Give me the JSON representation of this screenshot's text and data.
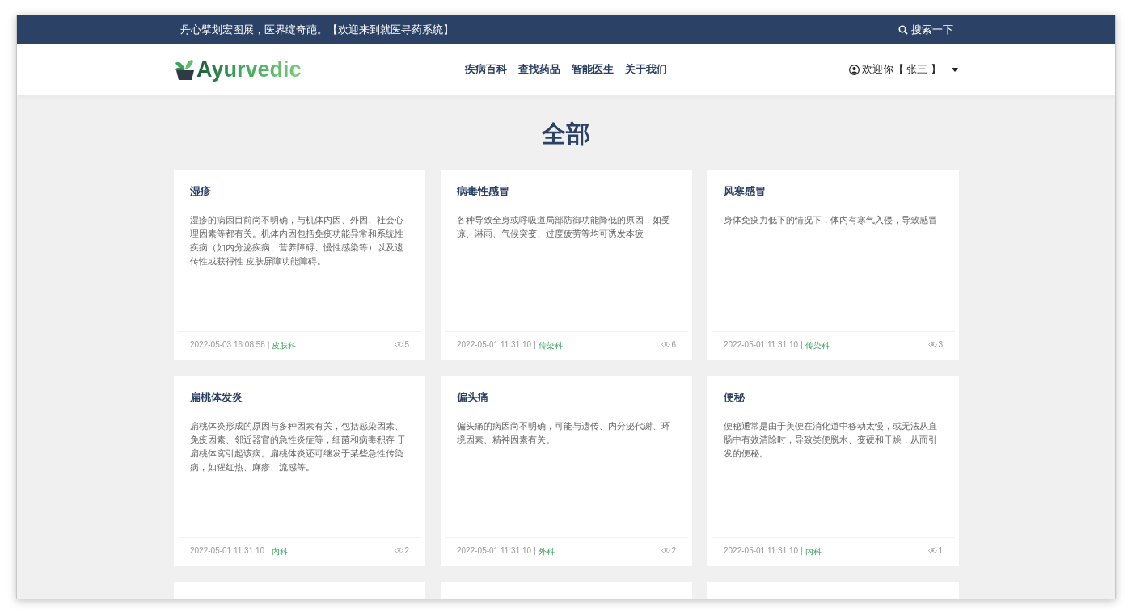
{
  "top_bar": {
    "slogan": "丹心擘划宏图展，医界绽奇葩。【欢迎来到就医寻药系统】",
    "search": "搜索一下"
  },
  "nav": {
    "logo": "Ayurvedic",
    "links": [
      {
        "label": "疾病百科"
      },
      {
        "label": "查找药品"
      },
      {
        "label": "智能医生"
      },
      {
        "label": "关于我们"
      }
    ],
    "user": "欢迎你【 张三 】"
  },
  "heading": "全部",
  "cards": [
    {
      "title": "湿疹",
      "description": "湿疹的病因目前尚不明确，与机体内因、外因、社会心理因素等都有关。机体内因包括免疫功能异常和系统性疾病（如内分泌疾病、营养障碍、慢性感染等）以及遗传性或获得性 皮肤屏障功能障碍。",
      "date": "2022-05-03 16:08:58",
      "separator": "|",
      "department": "皮肤科",
      "views": "5"
    },
    {
      "title": "病毒性感冒",
      "description": "各种导致全身或呼吸道局部防御功能降低的原因，如受凉、淋雨、气候突变、过度疲劳等均可诱发本疲",
      "date": "2022-05-01 11:31:10",
      "separator": "|",
      "department": "传染科",
      "views": "6"
    },
    {
      "title": "风寒感冒",
      "description": "身体免疫力低下的情况下，体内有寒气入侵，导致感冒",
      "date": "2022-05-01 11:31:10",
      "separator": "|",
      "department": "传染科",
      "views": "3"
    },
    {
      "title": "扁桃体发炎",
      "description": "扁桃体炎形成的原因与多种因素有关，包括感染因素、免疫因素、邻近器官的急性炎症等，细菌和病毒积存 于扁桃体窝引起该病。扁桃体炎还可继发于某些急性传染病，如猩红热、麻疹、流感等。",
      "date": "2022-05-01 11:31:10",
      "separator": "|",
      "department": "内科",
      "views": "2"
    },
    {
      "title": "偏头痛",
      "description": "偏头痛的病因尚不明确，可能与遗传、内分泌代谢、环境因素、精神因素有关。",
      "date": "2022-05-01 11:31:10",
      "separator": "|",
      "department": "外科",
      "views": "2"
    },
    {
      "title": "便秘",
      "description": "便秘通常是由于美便在消化道中移动太慢，或无法从直肠中有效清除时，导致类便脱水、变硬和干燥，从而引发的便秘。",
      "date": "2022-05-01 11:31:10",
      "separator": "|",
      "department": "内科",
      "views": "1"
    }
  ]
}
